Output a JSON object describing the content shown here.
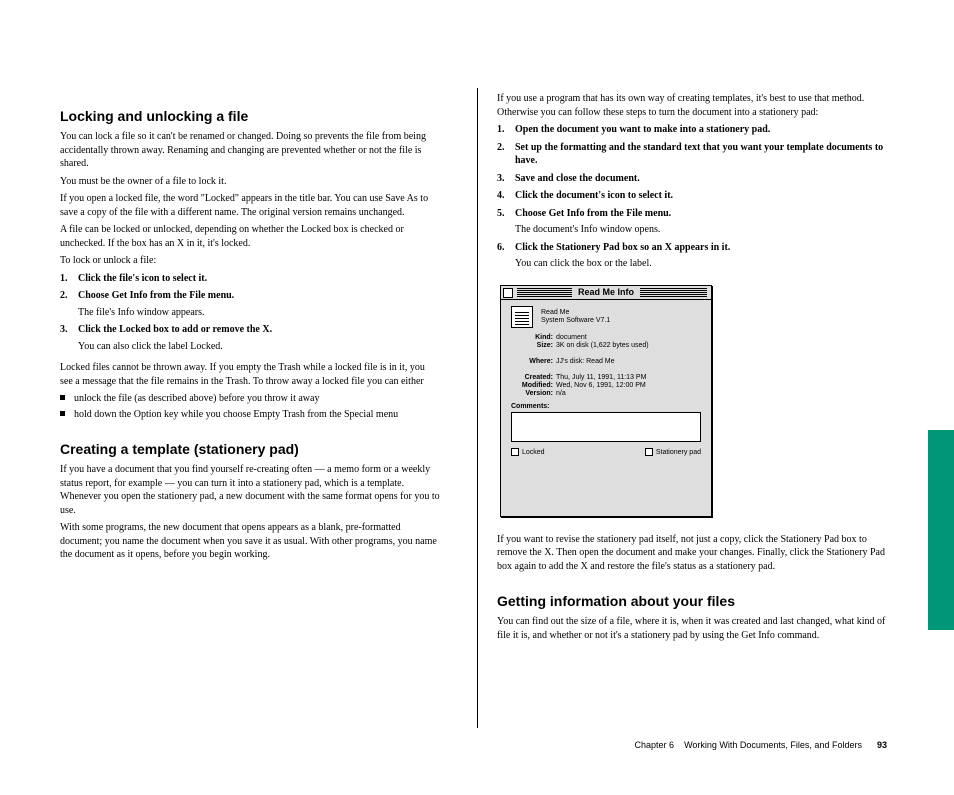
{
  "left": {
    "heading_lock_unlock": "Locking and unlocking a file",
    "lock_intro": "You can lock a file so it can't be renamed or changed. Doing so prevents the file from being accidentally thrown away. Renaming and changing are prevented whether or not the file is shared.",
    "lock_note": "You must be the owner of a file to lock it.",
    "lock_p2": "If you open a locked file, the word \"Locked\" appears in the title bar. You can use Save As to save a copy of the file with a different name. The original version remains unchanged.",
    "lock_p3": "A file can be locked or unlocked, depending on whether the Locked box is checked or unchecked. If the box has an X in it, it's locked.",
    "to_lock": "To lock or unlock a file:",
    "lock_steps": [
      {
        "text": "Click the file's icon to select it."
      },
      {
        "text": "Choose Get Info from the File menu.",
        "sub": "The file's Info window appears."
      },
      {
        "text": "Click the Locked box to add or remove the X.",
        "sub": "You can also click the label Locked."
      }
    ],
    "lock_locked_files": "Locked files cannot be thrown away. If you empty the Trash while a locked file is in it, you see a message that the file remains in the Trash. To throw away a locked file you can either",
    "lock_bullets": [
      "unlock the file (as described above) before you throw it away",
      "hold down the Option key while you choose Empty Trash from the Special menu"
    ],
    "heading_stationery": "Creating a template (stationery pad)",
    "stationery_intro": "If you have a document that you find yourself re-creating often — a memo form or a weekly status report, for example — you can turn it into a stationery pad, which is a template. Whenever you open the stationery pad, a new document with the same format opens for you to use.",
    "stationery_p2": "With some programs, the new document that opens appears as a blank, pre-formatted document; you name the document when you save it as usual. With other programs, you name the document as it opens, before you begin working."
  },
  "right": {
    "p_std_format": "If you use a program that has its own way of creating templates, it's best to use that method. Otherwise you can follow these steps to turn the document into a stationery pad:",
    "steps": [
      {
        "text": "Open the document you want to make into a stationery pad."
      },
      {
        "text": "Set up the formatting and the standard text that you want your template documents to have."
      },
      {
        "text": "Save and close the document."
      },
      {
        "text": "Click the document's icon to select it."
      },
      {
        "text": "Choose Get Info from the File menu.",
        "sub": "The document's Info window opens."
      },
      {
        "text": "Click the Stationery Pad box so an X appears in it.",
        "sub": "You can click the box or the label."
      }
    ],
    "revise_p": "If you want to revise the stationery pad itself, not just a copy, click the Stationery Pad box to remove the X. Then open the document and make your changes. Finally, click the Stationery Pad box again to add the X and restore the file's status as a stationery pad.",
    "heading_info": "Getting information about your files",
    "info_p": "You can find out the size of a file, where it is, when it was created and last changed, what kind of file it is, and whether or not it's a stationery pad by using the Get Info command."
  },
  "info_window": {
    "title": "Read Me Info",
    "name": "Read Me",
    "app": "System Software V7.1",
    "kind_label": "Kind:",
    "kind": "document",
    "size_label": "Size:",
    "size": "3K on disk (1,622 bytes used)",
    "where_label": "Where:",
    "where": "JJ's disk: Read Me",
    "created_label": "Created:",
    "created": "Thu, July 11, 1991, 11:13 PM",
    "modified_label": "Modified:",
    "modified": "Wed, Nov 6, 1991, 12:00 PM",
    "version_label": "Version:",
    "version": "n/a",
    "comments_label": "Comments:",
    "locked_label": "Locked",
    "stationery_label": "Stationery pad"
  },
  "footer": {
    "chapter": "Chapter 6",
    "title": "Working With Documents, Files, and Folders",
    "page": "93"
  }
}
